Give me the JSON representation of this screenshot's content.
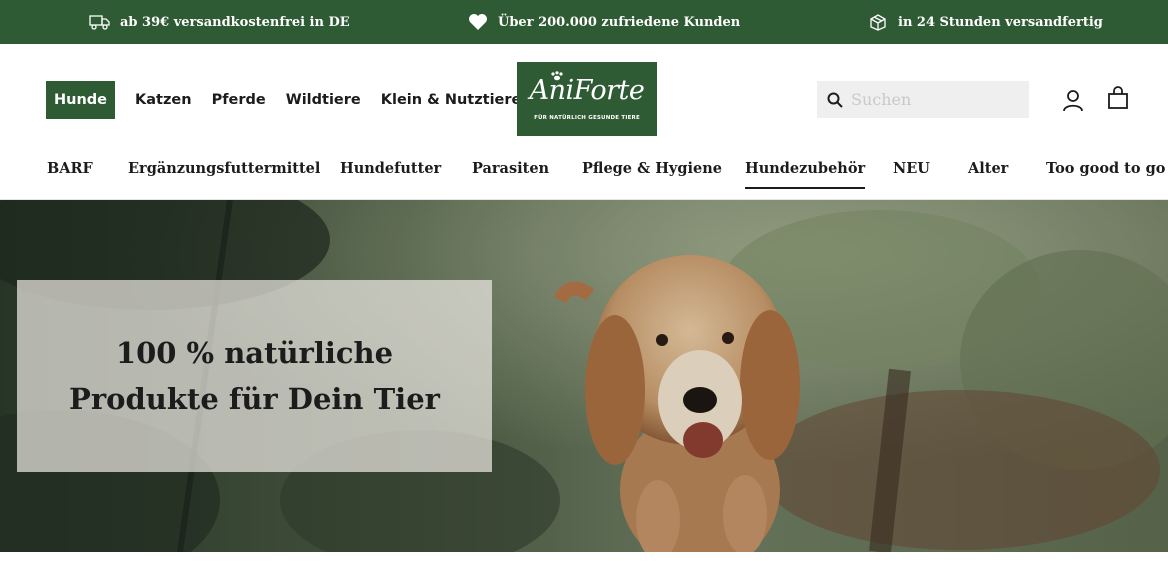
{
  "topbar": {
    "usps": [
      {
        "icon": "truck-icon",
        "text": "ab 39€ versandkostenfrei in DE"
      },
      {
        "icon": "heart-icon",
        "text": "Über 200.000 zufriedene Kunden"
      },
      {
        "icon": "package-icon",
        "text": "in 24 Stunden versandfertig"
      }
    ]
  },
  "header": {
    "animal_nav": [
      {
        "label": "Hunde",
        "active": true
      },
      {
        "label": "Katzen"
      },
      {
        "label": "Pferde"
      },
      {
        "label": "Wildtiere"
      },
      {
        "label": "Klein & Nutztiere"
      }
    ],
    "logo": {
      "word": "AniForte",
      "tagline": "FÜR NATÜRLICH GESUNDE TIERE"
    },
    "search": {
      "placeholder": "Suchen"
    },
    "icons": {
      "account": "user-icon",
      "cart": "shopping-bag-icon"
    }
  },
  "category_nav": [
    {
      "label": "BARF"
    },
    {
      "label": "Ergänzungsfuttermittel"
    },
    {
      "label": "Hundefutter"
    },
    {
      "label": "Parasiten"
    },
    {
      "label": "Pflege & Hygiene"
    },
    {
      "label": "Hundezubehör",
      "active": true
    },
    {
      "label": "NEU"
    },
    {
      "label": "Alter"
    },
    {
      "label": "Too good to go"
    }
  ],
  "hero": {
    "headline_line1": "100 % natürliche",
    "headline_line2": "Produkte für Dein Tier"
  },
  "colors": {
    "brand_green": "#2e5a34",
    "search_bg": "#efefef"
  }
}
